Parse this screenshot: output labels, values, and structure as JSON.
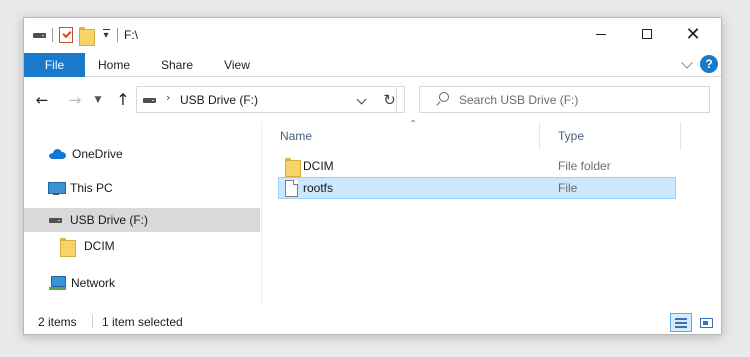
{
  "window": {
    "title": "F:\\",
    "controls": {
      "minimize": "minimize",
      "maximize": "maximize",
      "close": "✕"
    }
  },
  "ribbon": {
    "tabs": [
      "File",
      "Home",
      "Share",
      "View"
    ],
    "help": "?"
  },
  "navbar": {
    "back": "←",
    "forward": "→",
    "up": "↑",
    "address": "USB Drive (F:)",
    "refresh": "↻",
    "search_placeholder": "Search USB Drive (F:)"
  },
  "navpane": {
    "items": [
      {
        "label": "OneDrive",
        "icon": "onedrive-cloud-icon"
      },
      {
        "label": "This PC",
        "icon": "computer-icon"
      },
      {
        "label": "USB Drive (F:)",
        "icon": "usb-drive-icon",
        "selected": true
      },
      {
        "label": "DCIM",
        "icon": "folder-icon"
      },
      {
        "label": "Network",
        "icon": "network-icon"
      }
    ]
  },
  "filelist": {
    "columns": {
      "name": "Name",
      "type": "Type"
    },
    "rows": [
      {
        "name": "DCIM",
        "type": "File folder",
        "icon": "folder-icon",
        "selected": false
      },
      {
        "name": "rootfs",
        "type": "File",
        "icon": "file-icon",
        "selected": true
      }
    ]
  },
  "status": {
    "item_count": "2 items",
    "selection": "1 item selected"
  },
  "colors": {
    "accent": "#1979ca",
    "selection_bg": "#cce8ff",
    "selection_border": "#99d1ff",
    "nav_selected_bg": "#d9d9d9"
  }
}
